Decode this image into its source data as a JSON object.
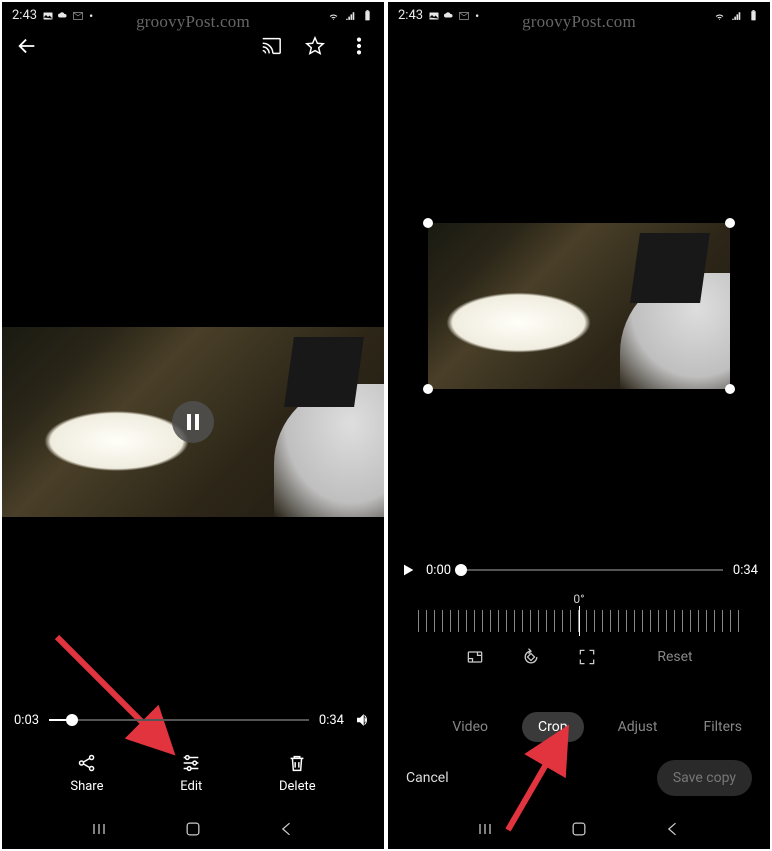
{
  "watermark": "groovyPost.com",
  "status": {
    "time": "2:43"
  },
  "screen1": {
    "scrub": {
      "elapsed": "0:03",
      "total": "0:34"
    },
    "actions": {
      "share": "Share",
      "edit": "Edit",
      "delete": "Delete"
    }
  },
  "screen2": {
    "scrub": {
      "elapsed": "0:00",
      "total": "0:34"
    },
    "rotation": "0°",
    "reset": "Reset",
    "tabs": {
      "video": "Video",
      "crop": "Crop",
      "adjust": "Adjust",
      "filters": "Filters"
    },
    "cancel": "Cancel",
    "save": "Save copy"
  }
}
